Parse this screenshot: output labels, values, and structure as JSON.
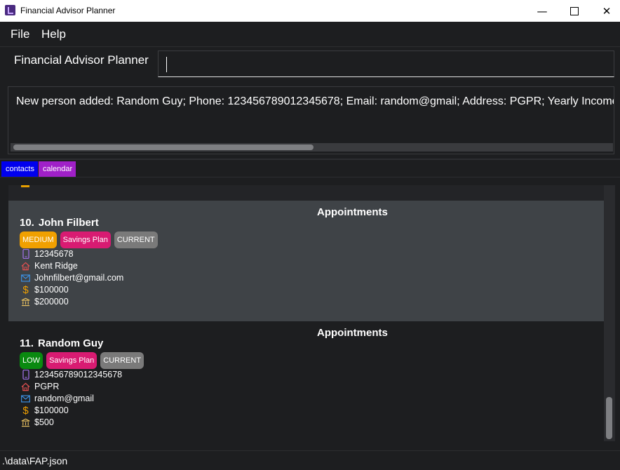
{
  "window": {
    "title": "Financial Advisor Planner"
  },
  "menu": {
    "file": "File",
    "help": "Help"
  },
  "command": {
    "label": "Financial Advisor Planner",
    "value": ""
  },
  "result": {
    "text": "New person added: Random Guy; Phone: 123456789012345678; Email: random@gmail; Address: PGPR; Yearly Income"
  },
  "tabs": {
    "contacts": "contacts",
    "calendar": "calendar"
  },
  "persons": [
    {
      "index": "10.",
      "name": "John Filbert",
      "appointments": "Appointments",
      "risk": "MEDIUM",
      "plan": "Savings Plan",
      "status": "CURRENT",
      "phone": "12345678",
      "address": "Kent Ridge",
      "email": "Johnfilbert@gmail.com",
      "income": "$100000",
      "savings": "$200000"
    },
    {
      "index": "11.",
      "name": "Random Guy",
      "appointments": "Appointments",
      "risk": "LOW",
      "plan": "Savings Plan",
      "status": "CURRENT",
      "phone": "123456789012345678",
      "address": "PGPR",
      "email": "random@gmail",
      "income": "$100000",
      "savings": "$500"
    }
  ],
  "colors": {
    "risk_medium": "#f0a000",
    "risk_low": "#0a8a10",
    "plan": "#d81b72",
    "status": "#7a7a7a",
    "phone_icon": "#9b6fe0",
    "address_icon": "#e05050",
    "email_icon": "#3d8fe0",
    "income_icon": "#f0a000",
    "savings_icon": "#e8c060"
  },
  "icons": {
    "phone": "phone-icon",
    "address": "home-icon",
    "email": "mail-icon",
    "income": "dollar-icon",
    "savings": "bank-icon"
  },
  "status": {
    "path": ".\\data\\FAP.json"
  }
}
